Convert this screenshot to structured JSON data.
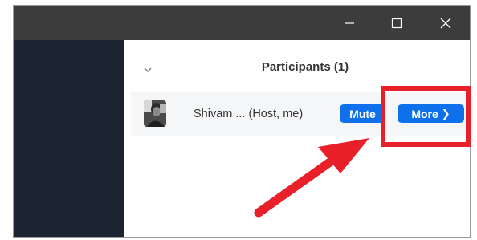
{
  "window": {
    "controls": [
      {
        "name": "minimize-button",
        "icon": "minimize-icon"
      },
      {
        "name": "maximize-button",
        "icon": "maximize-icon"
      },
      {
        "name": "close-button",
        "icon": "close-icon"
      }
    ]
  },
  "panel": {
    "title": "Participants (1)",
    "collapse_icon": "chevron-down-icon"
  },
  "participants": [
    {
      "name": "Shivam ...",
      "role": "(Host, me)",
      "name_display": "Shivam ...  (Host, me)",
      "mute_label": "Mute",
      "more_label": "More"
    }
  ],
  "annotation": {
    "highlight_color": "#e8202a",
    "arrow_color": "#e8202a"
  },
  "colors": {
    "titlebar": "#3c3c3c",
    "sidebar": "#1c2331",
    "accent_button": "#0e71eb"
  }
}
